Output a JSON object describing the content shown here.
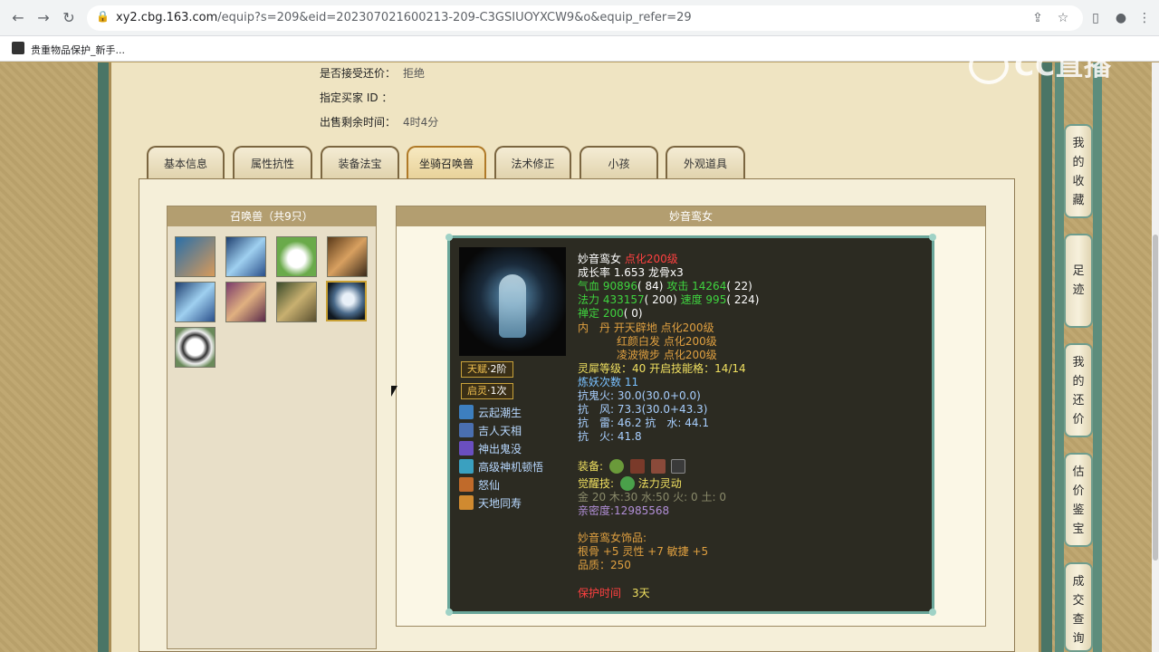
{
  "browser": {
    "url_host": "xy2.cbg.163.com",
    "url_rest": "/equip?s=209&eid=202307021600213-209-C3GSIUOYXCW9&o&equip_refer=29",
    "bookmark_label": "贵重物品保护_新手..."
  },
  "info": {
    "accept_bargain_label": "是否接受还价：",
    "accept_bargain_value": "拒绝",
    "buyer_id_label": "指定买家 ID ：",
    "buyer_id_value": "",
    "time_left_label": "出售剩余时间：",
    "time_left_value": "4时4分"
  },
  "tabs": [
    "基本信息",
    "属性抗性",
    "装备法宝",
    "坐骑召唤兽",
    "法术修正",
    "小孩",
    "外观道具"
  ],
  "active_tab": 3,
  "pet_panel": {
    "title": "召唤兽（共9只）",
    "count": 9,
    "selected": 7
  },
  "detail": {
    "title": "妙音鸾女",
    "name": "妙音鸾女",
    "name_note": "点化200级",
    "growth": "成长率 1.653 龙骨x3",
    "hp_label": "气血",
    "hp": "90896",
    "hp_pts": "( 84)",
    "atk_label": "攻击",
    "atk": "14264",
    "atk_pts": "( 22)",
    "mp_label": "法力",
    "mp": "433157",
    "mp_pts": "( 200)",
    "spd_label": "速度",
    "spd": "995",
    "spd_pts": "( 224)",
    "focus_label": "禅定",
    "focus": "200",
    "focus_pts": "( 0)",
    "neidan_label": "内　丹",
    "neidan_1": "开天辟地 点化200级",
    "neidan_2": "红颜白发 点化200级",
    "neidan_3": "凌波微步 点化200级",
    "lingxi": "灵犀等级：40 开启技能格：14/14",
    "lianyao": "炼妖次数 11",
    "res_ghost": "抗鬼火: 30.0(30.0+0.0)",
    "res_wind": "抗　风: 73.3(30.0+43.3)",
    "res_thunder_water": "抗　雷: 46.2 抗　水: 44.1",
    "res_fire": "抗　火: 41.8",
    "equip_label": "装备:",
    "awaken_label": "觉醒技:",
    "awaken_skill": "法力灵动",
    "elements": "金 20 木:30 水:50 火: 0 土: 0",
    "intimacy": "亲密度:12985568",
    "accessory_title": "妙音鸾女饰品:",
    "accessory_stats": "根骨 +5 灵性 +7 敏捷 +5",
    "quality": "品质：250",
    "protect_label": "保护时间",
    "protect_value": "3天"
  },
  "badges": [
    {
      "main": "天赋",
      "sub": "·2阶"
    },
    {
      "main": "启灵",
      "sub": "·1次"
    }
  ],
  "skills": [
    {
      "name": "云起潮生",
      "icon": "wave-skill-icon",
      "color": "#3d7fbf"
    },
    {
      "name": "吉人天相",
      "icon": "fortune-skill-icon",
      "color": "#4a6fb0"
    },
    {
      "name": "神出鬼没",
      "icon": "ghost-skill-icon",
      "color": "#6a4fc0"
    },
    {
      "name": "高级神机顿悟",
      "icon": "insight-skill-icon",
      "color": "#3aa0c0"
    },
    {
      "name": "怒仙",
      "icon": "fury-skill-icon",
      "color": "#c06a2a"
    },
    {
      "name": "天地同寿",
      "icon": "longevity-skill-icon",
      "color": "#d08a30"
    }
  ],
  "sidebar": [
    {
      "label": [
        "我",
        "的",
        "收",
        "藏"
      ]
    },
    {
      "label": [
        "足",
        "迹"
      ]
    },
    {
      "label": [
        "我",
        "的",
        "还",
        "价"
      ]
    },
    {
      "label": [
        "估",
        "价",
        "鉴",
        "宝"
      ]
    },
    {
      "label": [
        "成",
        "交",
        "查",
        "询"
      ]
    }
  ],
  "watermark": "CC直播"
}
